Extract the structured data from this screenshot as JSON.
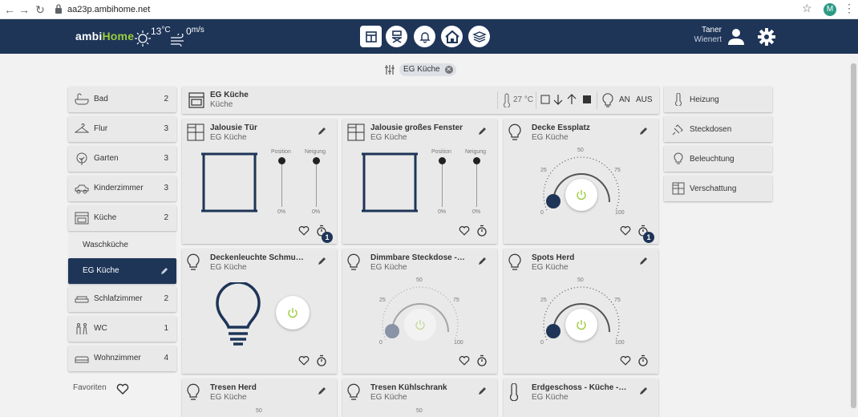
{
  "browser": {
    "url": "aa23p.ambihome.net",
    "profile_initial": "M"
  },
  "brand": {
    "part1": "ambi",
    "part2": "Home"
  },
  "weather": {
    "temperature": "13",
    "temp_unit": "°C",
    "wind": "0",
    "wind_unit": "m/s"
  },
  "nav": [
    "dashboard-icon",
    "chair-icon",
    "bell-icon",
    "home-icon",
    "layers-icon"
  ],
  "user": {
    "first_name": "Taner",
    "last_name": "Wienert"
  },
  "filter": {
    "chip_label": "EG Küche"
  },
  "rooms": [
    {
      "label": "Bad",
      "count": "2",
      "icon": "bathtub-icon"
    },
    {
      "label": "Flur",
      "count": "3",
      "icon": "hanger-icon"
    },
    {
      "label": "Garten",
      "count": "3",
      "icon": "tree-icon"
    },
    {
      "label": "Kinderzimmer",
      "count": "3",
      "icon": "toy-car-icon"
    },
    {
      "label": "Küche",
      "count": "2",
      "icon": "oven-icon"
    },
    {
      "label": "Waschküche",
      "count": ""
    },
    {
      "label": "EG Küche",
      "count": ""
    },
    {
      "label": "Schlafzimmer",
      "count": "2",
      "icon": "bed-icon"
    },
    {
      "label": "WC",
      "count": "1",
      "icon": "wc-icon"
    },
    {
      "label": "Wohnzimmer",
      "count": "4",
      "icon": "sofa-icon"
    }
  ],
  "favorites_label": "Favoriten",
  "room_header": {
    "title": "EG Küche",
    "subtitle": "Küche",
    "temperature": "27 °C",
    "on_label": "AN",
    "off_label": "AUS"
  },
  "categories": [
    {
      "label": "Heizung",
      "icon": "thermometer-icon"
    },
    {
      "label": "Steckdosen",
      "icon": "plug-icon"
    },
    {
      "label": "Beleuchtung",
      "icon": "bulb-icon"
    },
    {
      "label": "Verschattung",
      "icon": "window-icon"
    }
  ],
  "devices": [
    {
      "title": "Jalousie Tür",
      "room": "EG Küche",
      "type": "blind",
      "position_label": "Position",
      "tilt_label": "Neigung",
      "position_value": "0%",
      "tilt_value": "0%",
      "timers": "1"
    },
    {
      "title": "Jalousie großes Fenster",
      "room": "EG Küche",
      "type": "blind",
      "position_label": "Position",
      "tilt_label": "Neigung",
      "position_value": "0%",
      "tilt_value": "0%"
    },
    {
      "title": "Decke Essplatz",
      "room": "EG Küche",
      "type": "dimmer",
      "dial_labels": [
        "0",
        "25",
        "50",
        "75",
        "100"
      ],
      "level": 0,
      "timers": "1"
    },
    {
      "title": "Deckenleuchte Schmutzk...",
      "room": "EG Küche",
      "type": "switch"
    },
    {
      "title": "Dimmbare Steckdose - Vo...",
      "room": "EG Küche",
      "type": "dimmer",
      "dial_labels": [
        "0",
        "25",
        "50",
        "75",
        "100"
      ],
      "level": 0,
      "disabled": true
    },
    {
      "title": "Spots Herd",
      "room": "EG Küche",
      "type": "dimmer",
      "dial_labels": [
        "0",
        "25",
        "50",
        "75",
        "100"
      ],
      "level": 0
    },
    {
      "title": "Tresen Herd",
      "room": "EG Küche",
      "type": "dimmer",
      "dial_labels": [
        "50"
      ]
    },
    {
      "title": "Tresen Kühlschrank",
      "room": "EG Küche",
      "type": "dimmer",
      "dial_labels": [
        "50"
      ]
    },
    {
      "title": "Erdgeschoss - Küche - Hei...",
      "room": "EG Küche",
      "type": "heating"
    }
  ],
  "colors": {
    "navy": "#1e3558",
    "accent_green": "#9ccd3c",
    "card": "#e9e9e9"
  }
}
